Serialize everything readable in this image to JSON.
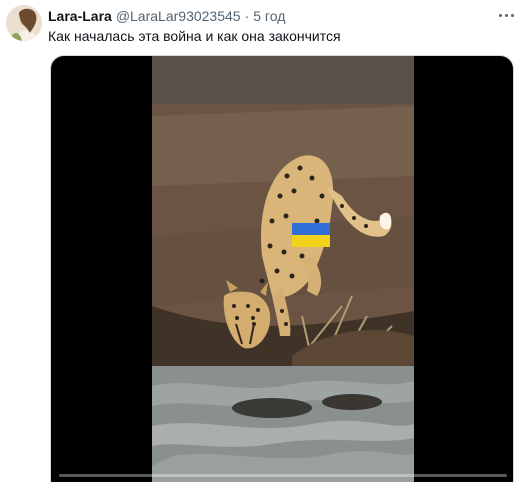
{
  "tweet": {
    "author": {
      "display_name": "Lara-Lara",
      "handle": "@LaraLar93023545",
      "avatar_icon": "user-avatar-photo"
    },
    "separator": "·",
    "time": "5 год",
    "text": "Как началась эта война и как она закончится",
    "more_icon": "more-options-icon"
  },
  "media": {
    "type": "video",
    "progress": 0.0,
    "flag_colors": {
      "top": "#2f6fd6",
      "bottom": "#f2d21b"
    }
  }
}
